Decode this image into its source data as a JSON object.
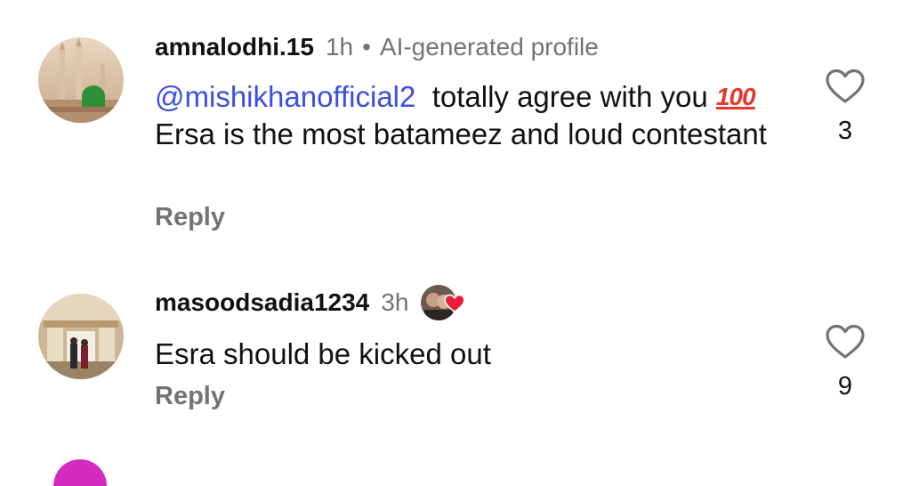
{
  "comments": [
    {
      "username": "amnalodhi.15",
      "time": "1h",
      "separator": "•",
      "label": "AI-generated profile",
      "mention": "@mishikhanofficial2",
      "text_before_emoji": "totally agree with you",
      "emoji": "100-emoji",
      "emoji_text": "100",
      "text_after_emoji": "Ersa is the most batameez and loud contestant",
      "reply": "Reply",
      "likes": "3",
      "heart_icon": "heart-outline-icon"
    },
    {
      "username": "masoodsadia1234",
      "time": "3h",
      "text": "Esra should be kicked out",
      "reply": "Reply",
      "likes": "9",
      "heart_icon": "heart-outline-icon",
      "creator_liked_icon": "red-heart-icon"
    }
  ],
  "colors": {
    "mention": "#3b4fe0",
    "secondary_text": "#737373",
    "primary_text": "#111111",
    "liked_heart": "#ed1c3c"
  }
}
